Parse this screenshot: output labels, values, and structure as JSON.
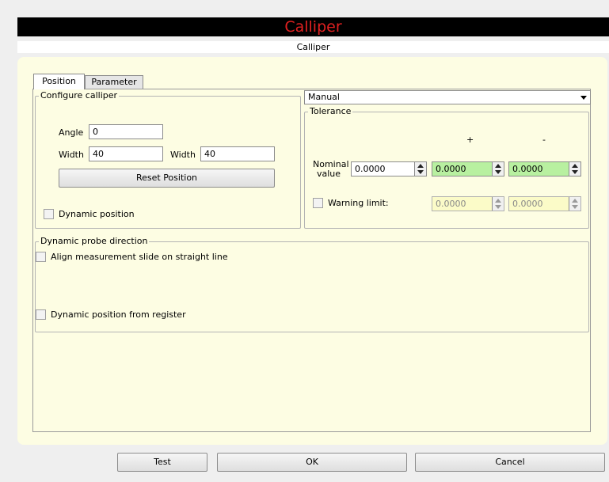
{
  "window": {
    "title": "Calliper",
    "subtitle": "Calliper",
    "title_color": "#e02020"
  },
  "tabs": [
    {
      "label": "Position",
      "active": true
    },
    {
      "label": "Parameter",
      "active": false
    }
  ],
  "configure": {
    "title": "Configure calliper",
    "angle_label": "Angle",
    "angle_value": "0",
    "width1_label": "Width",
    "width1_value": "40",
    "width2_label": "Width",
    "width2_value": "40",
    "reset_button": "Reset Position",
    "dynamic_position_label": "Dynamic position"
  },
  "mode_select": {
    "value": "Manual"
  },
  "tolerance": {
    "title": "Tolerance",
    "plus_header": "+",
    "minus_header": "-",
    "nominal_label_line1": "Nominal",
    "nominal_label_line2": "value",
    "nominal_value": "0.0000",
    "plus_value": "0.0000",
    "minus_value": "0.0000",
    "warning_label": "Warning limit:",
    "warning_plus_value": "0.0000",
    "warning_minus_value": "0.0000",
    "green_color": "#b8f0a0",
    "yellow_color": "#fbfbc8"
  },
  "probe": {
    "title": "Dynamic probe direction",
    "align_label": "Align measurement slide on straight line",
    "register_label": "Dynamic position from register"
  },
  "buttons": {
    "test": "Test",
    "ok": "OK",
    "cancel": "Cancel"
  }
}
